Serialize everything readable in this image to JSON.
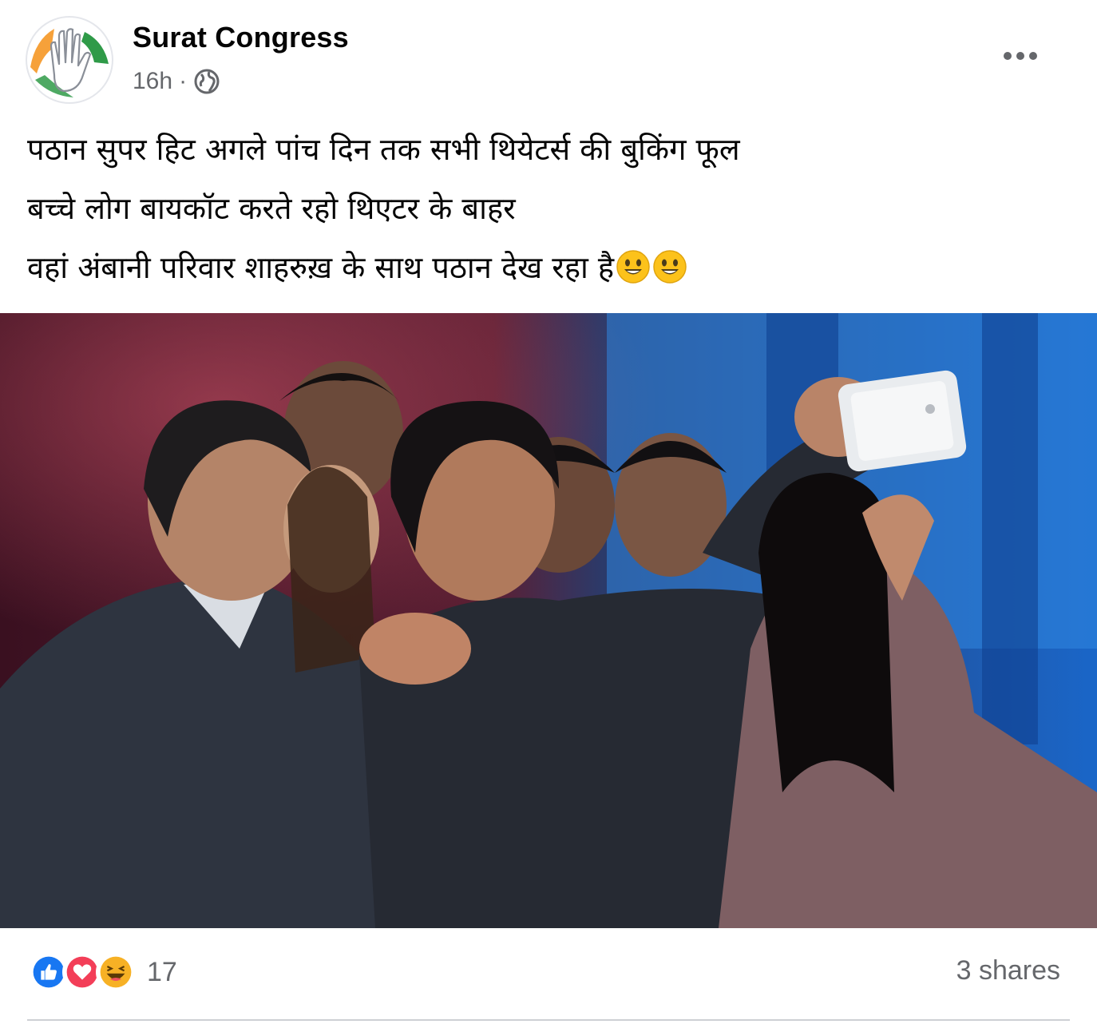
{
  "post": {
    "author": "Surat Congress",
    "time": "16h",
    "separator": "·",
    "audience_icon": "globe-icon",
    "more_icon": "ellipsis-icon",
    "text_lines": [
      "पठान सुपर हिट अगले पांच दिन तक सभी थियेटर्स की बुकिंग फूल",
      "बच्चे लोग बायकॉट करते रहो थिएटर के बाहर",
      "वहां अंबानी परिवार शाहरुख़ के साथ पठान देख रहा है"
    ],
    "trailing_emojis": [
      "smiley-emoji",
      "smiley-emoji"
    ],
    "photo_description_icon": "group-selfie-photo"
  },
  "footer": {
    "reaction_icons": [
      "like-icon",
      "love-icon",
      "haha-icon"
    ],
    "reaction_count": "17",
    "shares": "3 shares"
  },
  "colors": {
    "like": "#1877f2",
    "love": "#f33e58",
    "haha": "#f7b125",
    "secondary_text": "#65676b"
  }
}
